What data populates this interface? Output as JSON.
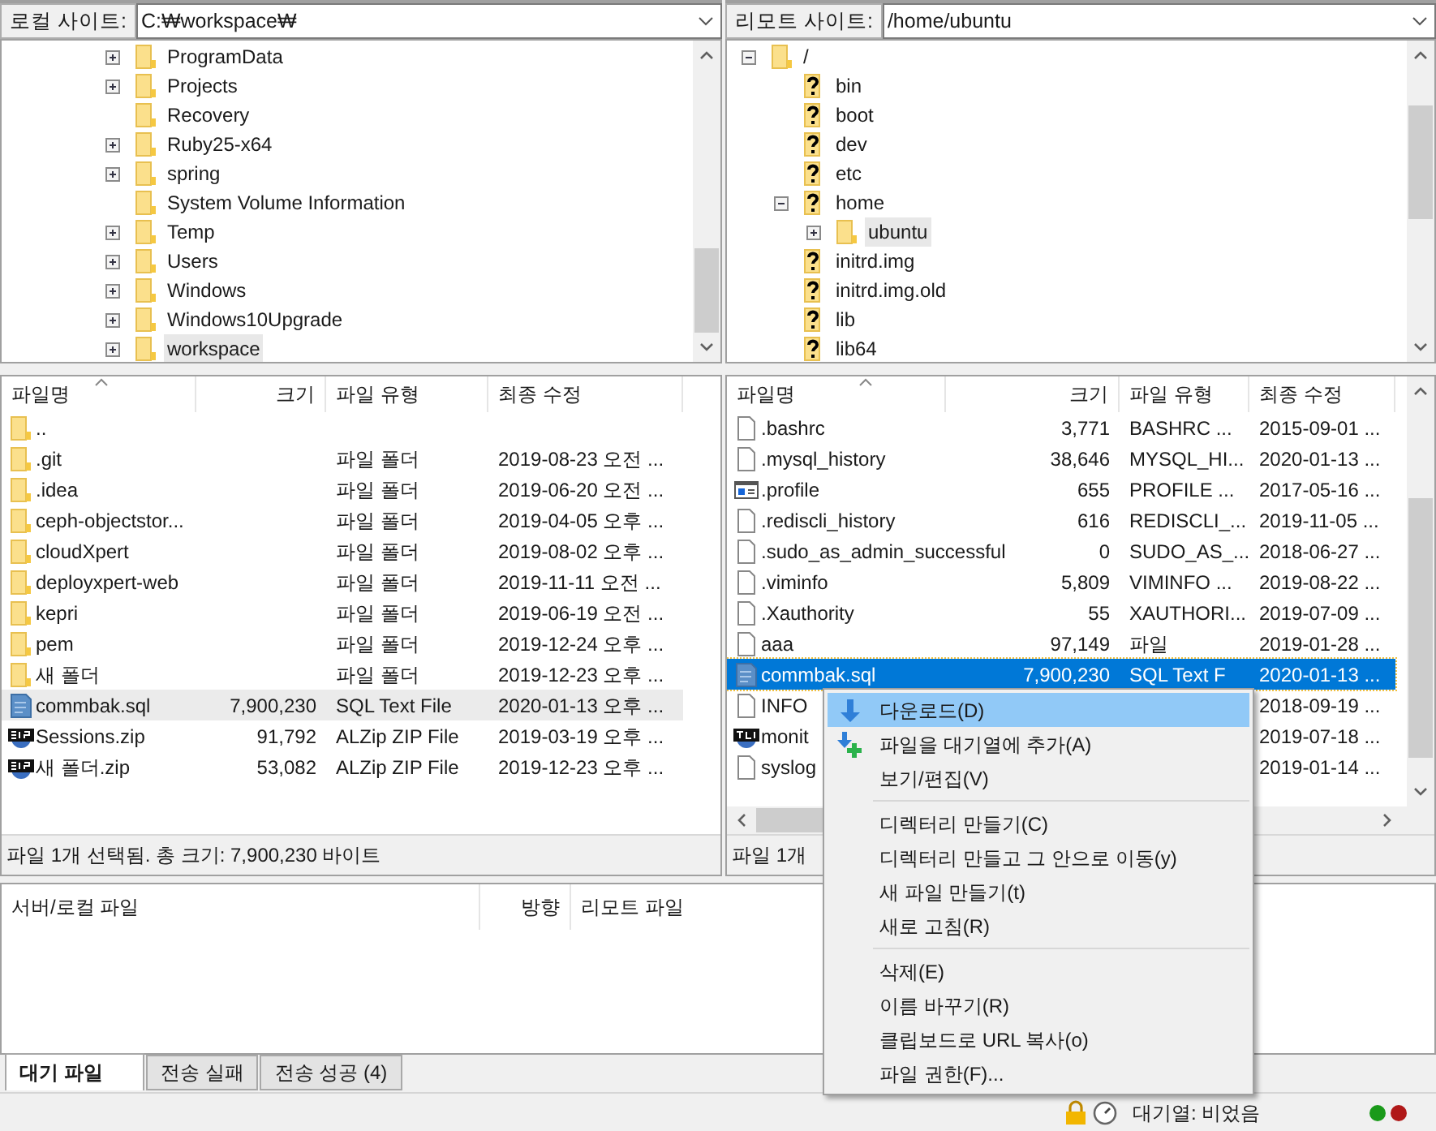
{
  "local": {
    "site_label": "로컬 사이트:",
    "path": "C:₩workspace₩",
    "tree": [
      {
        "name": "ProgramData",
        "expandable": true,
        "selected": false,
        "kind": "folder"
      },
      {
        "name": "Projects",
        "expandable": true,
        "selected": false,
        "kind": "folder"
      },
      {
        "name": "Recovery",
        "expandable": false,
        "selected": false,
        "kind": "folder"
      },
      {
        "name": "Ruby25-x64",
        "expandable": true,
        "selected": false,
        "kind": "folder"
      },
      {
        "name": "spring",
        "expandable": true,
        "selected": false,
        "kind": "folder"
      },
      {
        "name": "System Volume Information",
        "expandable": false,
        "selected": false,
        "kind": "folder"
      },
      {
        "name": "Temp",
        "expandable": true,
        "selected": false,
        "kind": "folder"
      },
      {
        "name": "Users",
        "expandable": true,
        "selected": false,
        "kind": "folder"
      },
      {
        "name": "Windows",
        "expandable": true,
        "selected": false,
        "kind": "folder"
      },
      {
        "name": "Windows10Upgrade",
        "expandable": true,
        "selected": false,
        "kind": "folder"
      },
      {
        "name": "workspace",
        "expandable": true,
        "selected": true,
        "kind": "folder"
      }
    ],
    "columns": [
      "파일명",
      "크기",
      "파일 유형",
      "최종 수정"
    ],
    "active": false,
    "files": [
      {
        "kind": "folder",
        "name": "..",
        "selected": false
      },
      {
        "kind": "folder",
        "name": ".git",
        "type": "파일 폴더",
        "modified": "2019-08-23 오전 ...",
        "selected": false
      },
      {
        "kind": "folder",
        "name": ".idea",
        "type": "파일 폴더",
        "modified": "2019-06-20 오전 ...",
        "selected": false
      },
      {
        "kind": "folder",
        "name": "ceph-objectstor...",
        "type": "파일 폴더",
        "modified": "2019-04-05 오후 ...",
        "selected": false
      },
      {
        "kind": "folder",
        "name": "cloudXpert",
        "type": "파일 폴더",
        "modified": "2019-08-02 오후 ...",
        "selected": false
      },
      {
        "kind": "folder",
        "name": "deployxpert-web",
        "type": "파일 폴더",
        "modified": "2019-11-11 오전 ...",
        "selected": false
      },
      {
        "kind": "folder",
        "name": "kepri",
        "type": "파일 폴더",
        "modified": "2019-06-19 오전 ...",
        "selected": false
      },
      {
        "kind": "folder",
        "name": "pem",
        "type": "파일 폴더",
        "modified": "2019-12-24 오후 ...",
        "selected": false
      },
      {
        "kind": "folder",
        "name": "새 폴더",
        "type": "파일 폴더",
        "modified": "2019-12-23 오후 ...",
        "selected": false
      },
      {
        "kind": "sql",
        "name": "commbak.sql",
        "size": "7,900,230",
        "type": "SQL Text File",
        "modified": "2020-01-13 오후 ...",
        "selected": true
      },
      {
        "kind": "zip",
        "name": "Sessions.zip",
        "size": "91,792",
        "type": "ALZip ZIP File",
        "modified": "2019-03-19 오후 ...",
        "selected": false
      },
      {
        "kind": "zip",
        "name": "새 폴더.zip",
        "size": "53,082",
        "type": "ALZip ZIP File",
        "modified": "2019-12-23 오후 ...",
        "selected": false
      }
    ],
    "status": "파일 1개 선택됨. 총 크기: 7,900,230 바이트"
  },
  "remote": {
    "site_label": "리모트 사이트:",
    "path": "/home/ubuntu",
    "tree": [
      {
        "name": "/",
        "kind": "folder",
        "expandable": true,
        "expanded": true,
        "selected": false,
        "children": [
          {
            "name": "bin",
            "kind": "unknown",
            "expandable": false,
            "selected": false
          },
          {
            "name": "boot",
            "kind": "unknown",
            "expandable": false,
            "selected": false
          },
          {
            "name": "dev",
            "kind": "unknown",
            "expandable": false,
            "selected": false
          },
          {
            "name": "etc",
            "kind": "unknown",
            "expandable": false,
            "selected": false
          },
          {
            "name": "home",
            "kind": "unknown",
            "expandable": true,
            "expanded": true,
            "selected": false,
            "children": [
              {
                "name": "ubuntu",
                "kind": "folder",
                "expandable": true,
                "expanded": false,
                "selected": true
              }
            ]
          },
          {
            "name": "initrd.img",
            "kind": "unknown",
            "expandable": false,
            "selected": false
          },
          {
            "name": "initrd.img.old",
            "kind": "unknown",
            "expandable": false,
            "selected": false
          },
          {
            "name": "lib",
            "kind": "unknown",
            "expandable": false,
            "selected": false
          },
          {
            "name": "lib64",
            "kind": "unknown",
            "expandable": false,
            "selected": false
          }
        ]
      }
    ],
    "columns": [
      "파일명",
      "크기",
      "파일 유형",
      "최종 수정"
    ],
    "active": true,
    "files": [
      {
        "kind": "file",
        "name": ".bashrc",
        "size": "3,771",
        "type": "BASHRC ...",
        "modified": "2015-09-01 ...",
        "selected": false
      },
      {
        "kind": "file",
        "name": ".mysql_history",
        "size": "38,646",
        "type": "MYSQL_HI...",
        "modified": "2020-01-13 ...",
        "selected": false
      },
      {
        "kind": "profile",
        "name": ".profile",
        "size": "655",
        "type": "PROFILE ...",
        "modified": "2017-05-16 ...",
        "selected": false
      },
      {
        "kind": "file",
        "name": ".rediscli_history",
        "size": "616",
        "type": "REDISCLI_...",
        "modified": "2019-11-05 ...",
        "selected": false
      },
      {
        "kind": "file",
        "name": ".sudo_as_admin_successful",
        "size": "0",
        "type": "SUDO_AS_...",
        "modified": "2018-06-27 ...",
        "selected": false
      },
      {
        "kind": "file",
        "name": ".viminfo",
        "size": "5,809",
        "type": "VIMINFO ...",
        "modified": "2019-08-22 ...",
        "selected": false
      },
      {
        "kind": "file",
        "name": ".Xauthority",
        "size": "55",
        "type": "XAUTHORI...",
        "modified": "2019-07-09 ...",
        "selected": false
      },
      {
        "kind": "file",
        "name": "aaa",
        "size": "97,149",
        "type": "파일",
        "modified": "2019-01-28 ...",
        "selected": false
      },
      {
        "kind": "sql",
        "name": "commbak.sql",
        "size": "7,900,230",
        "type": "SQL Text F",
        "modified": "2020-01-13 ...",
        "selected": true
      },
      {
        "kind": "file",
        "name": "INFO",
        "modified": "2018-09-19 ...",
        "selected": false
      },
      {
        "kind": "tar",
        "name": "monit",
        "modified": "2019-07-18 ...",
        "selected": false
      },
      {
        "kind": "file",
        "name": "syslog",
        "modified": "2019-01-14 ...",
        "selected": false
      }
    ],
    "status": "파일 1개"
  },
  "queue": {
    "columns": [
      "서버/로컬 파일",
      "방향",
      "리모트 파일"
    ]
  },
  "tabs": [
    {
      "label": "대기 파일",
      "selected": true
    },
    {
      "label": "전송 실패",
      "selected": false
    },
    {
      "label": "전송 성공 (4)",
      "selected": false
    }
  ],
  "status_bar": {
    "queue_text": "대기열: 비었음",
    "lights": [
      {
        "color": "#1a9a1a"
      },
      {
        "color": "#b01818"
      }
    ]
  },
  "context_menu": [
    {
      "kind": "download",
      "label": "다운로드(D)",
      "highlighted": true
    },
    {
      "kind": "enqueue",
      "label": "파일을 대기열에 추가(A)",
      "highlighted": false
    },
    {
      "kind": "item",
      "label": "보기/편집(V)",
      "highlighted": false
    },
    {
      "kind": "separator"
    },
    {
      "kind": "item",
      "label": "디렉터리 만들기(C)",
      "highlighted": false
    },
    {
      "kind": "item",
      "label": "디렉터리 만들고 그 안으로 이동(y)",
      "highlighted": false
    },
    {
      "kind": "item",
      "label": "새 파일 만들기(t)",
      "highlighted": false
    },
    {
      "kind": "item",
      "label": "새로 고침(R)",
      "highlighted": false
    },
    {
      "kind": "separator"
    },
    {
      "kind": "item",
      "label": "삭제(E)",
      "highlighted": false
    },
    {
      "kind": "item",
      "label": "이름 바꾸기(R)",
      "highlighted": false
    },
    {
      "kind": "item",
      "label": "클립보드로 URL 복사(o)",
      "highlighted": false
    },
    {
      "kind": "item",
      "label": "파일 권한(F)...",
      "highlighted": false
    }
  ]
}
